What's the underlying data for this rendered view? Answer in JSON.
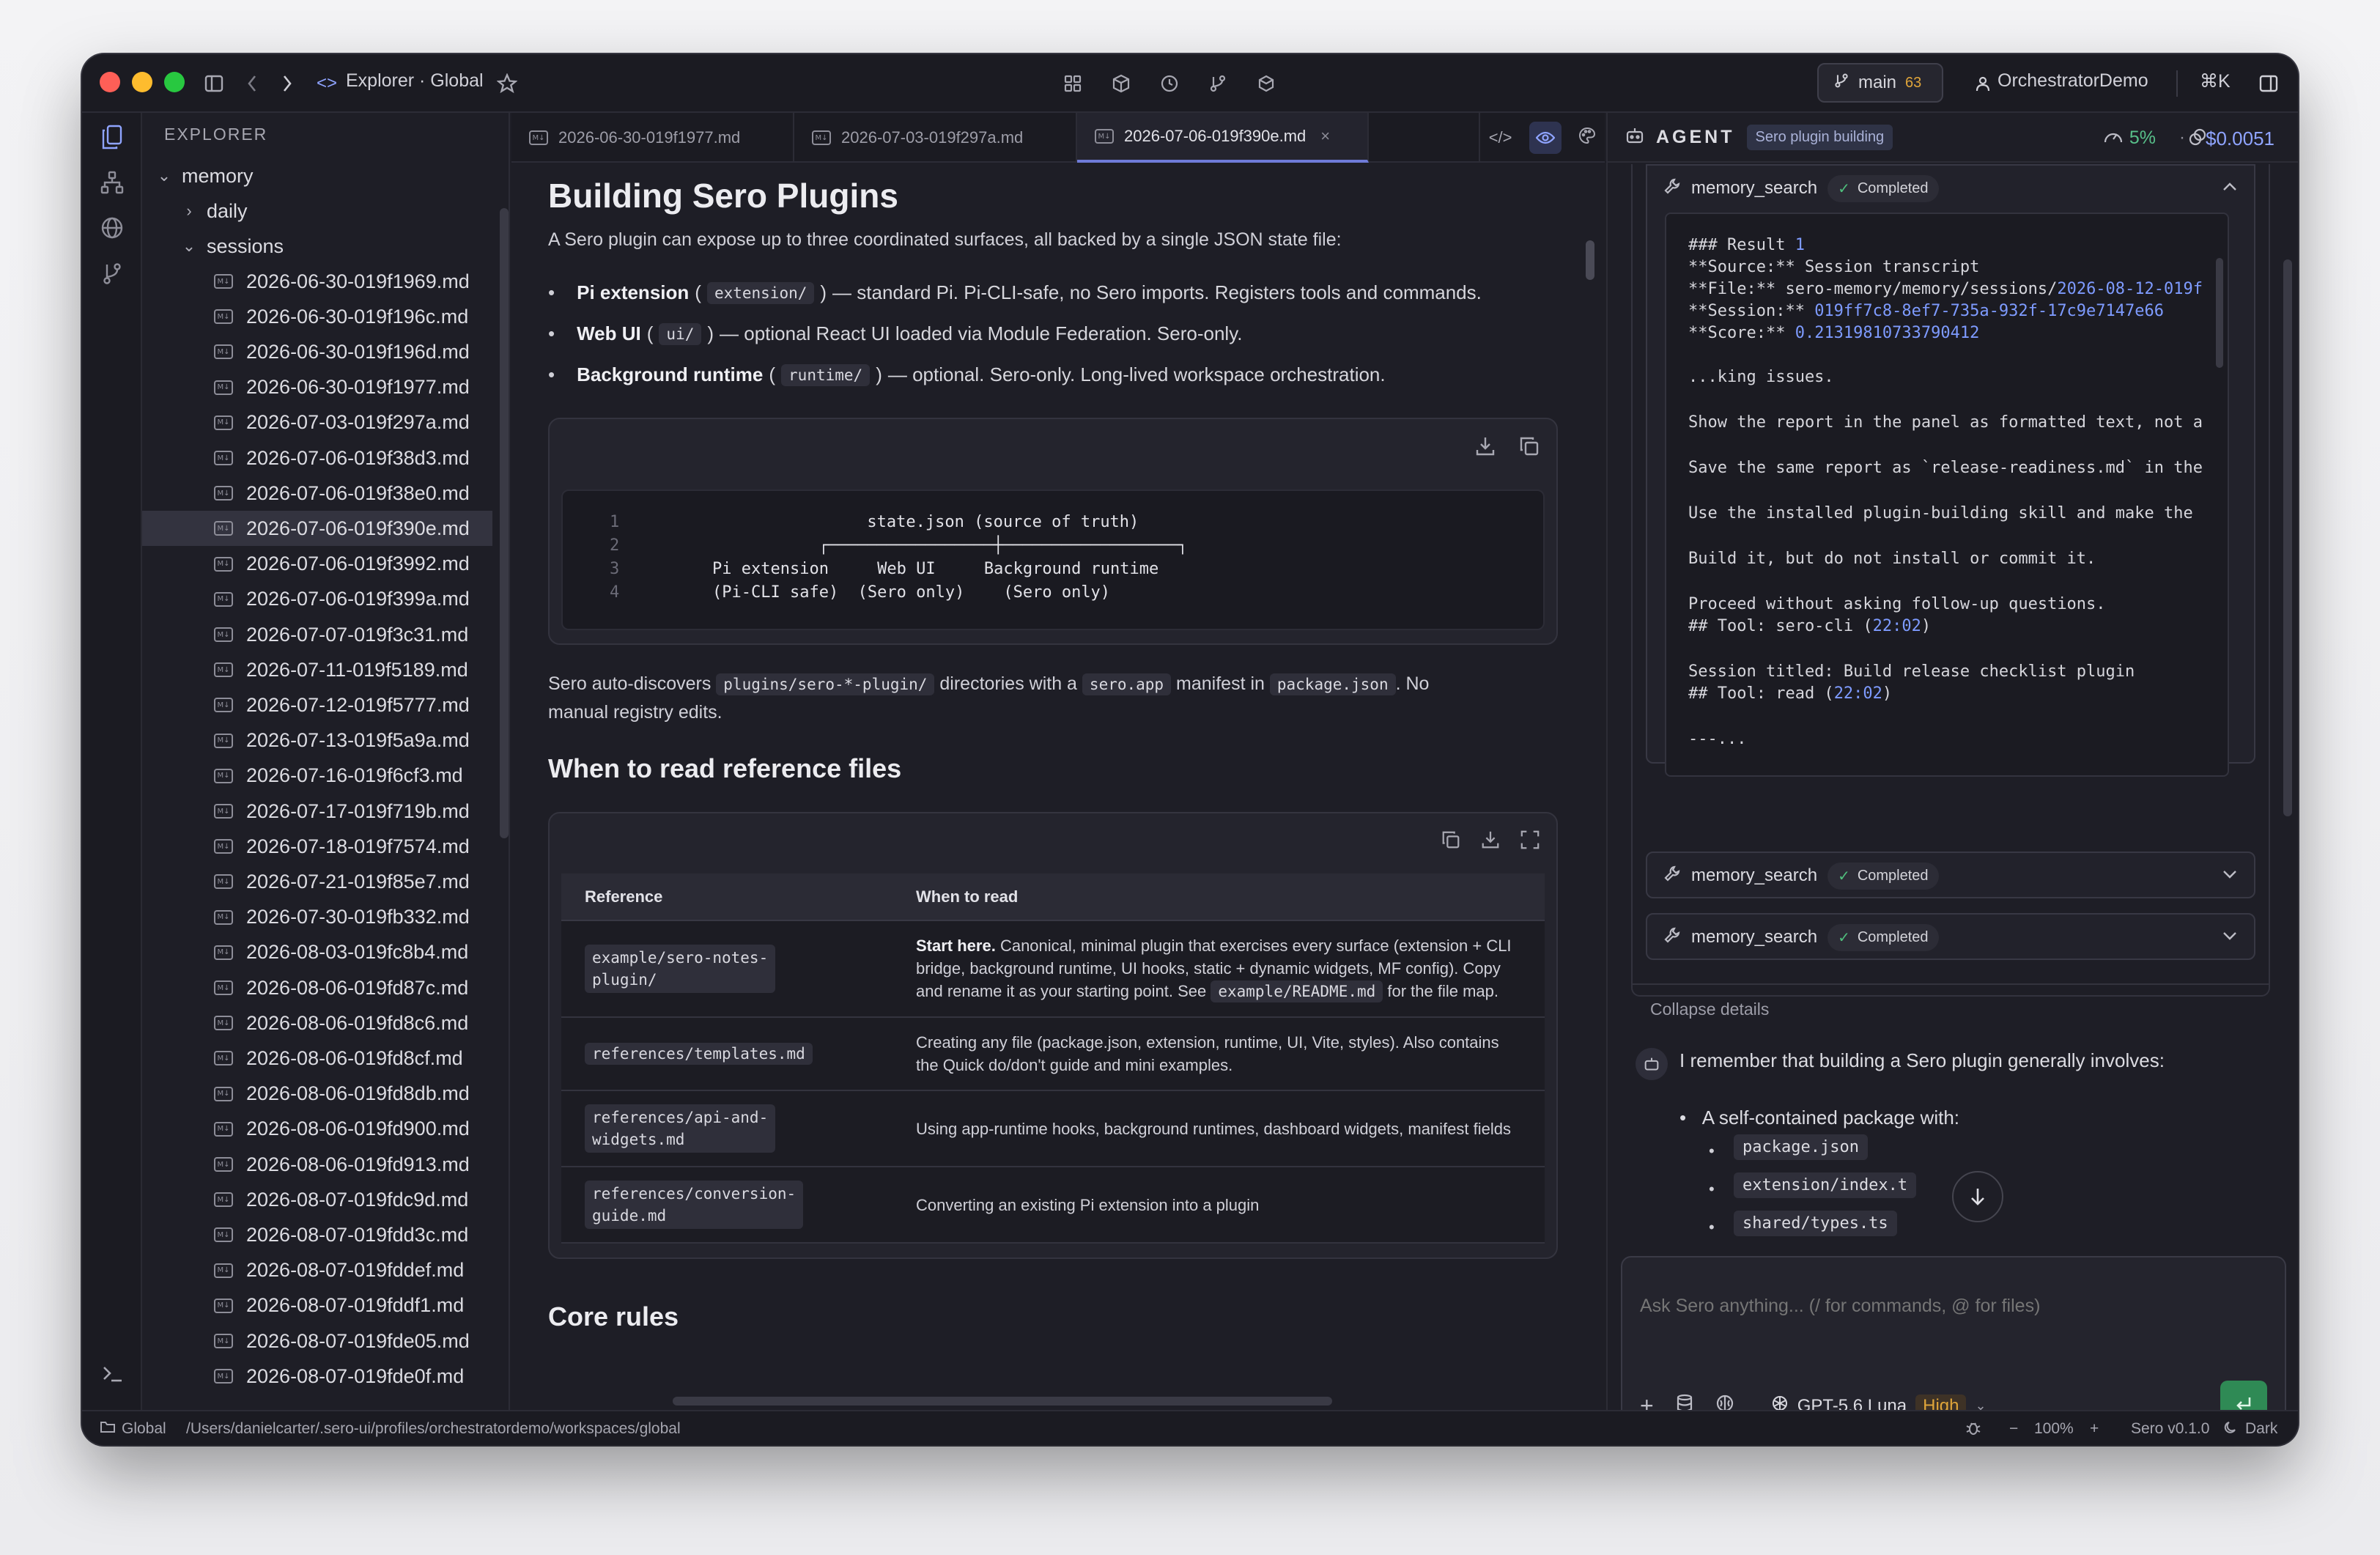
{
  "titlebar": {
    "breadcrumb": "Explorer · Global",
    "branch": "main",
    "branch_count": "63",
    "user": "OrchestratorDemo",
    "shortcut": "⌘K"
  },
  "sidebar": {
    "title": "EXPLORER",
    "folders": {
      "root": "memory",
      "daily": "daily",
      "sessions": "sessions"
    },
    "files": [
      "2026-06-30-019f1969.md",
      "2026-06-30-019f196c.md",
      "2026-06-30-019f196d.md",
      "2026-06-30-019f1977.md",
      "2026-07-03-019f297a.md",
      "2026-07-06-019f38d3.md",
      "2026-07-06-019f38e0.md",
      "2026-07-06-019f390e.md",
      "2026-07-06-019f3992.md",
      "2026-07-06-019f399a.md",
      "2026-07-07-019f3c31.md",
      "2026-07-11-019f5189.md",
      "2026-07-12-019f5777.md",
      "2026-07-13-019f5a9a.md",
      "2026-07-16-019f6cf3.md",
      "2026-07-17-019f719b.md",
      "2026-07-18-019f7574.md",
      "2026-07-21-019f85e7.md",
      "2026-07-30-019fb332.md",
      "2026-08-03-019fc8b4.md",
      "2026-08-06-019fd87c.md",
      "2026-08-06-019fd8c6.md",
      "2026-08-06-019fd8cf.md",
      "2026-08-06-019fd8db.md",
      "2026-08-06-019fd900.md",
      "2026-08-06-019fd913.md",
      "2026-08-07-019fdc9d.md",
      "2026-08-07-019fdd3c.md",
      "2026-08-07-019fddef.md",
      "2026-08-07-019fddf1.md",
      "2026-08-07-019fde05.md",
      "2026-08-07-019fde0f.md"
    ]
  },
  "tabs": [
    {
      "label": "2026-06-30-019f1977.md"
    },
    {
      "label": "2026-07-03-019f297a.md"
    },
    {
      "label": "2026-07-06-019f390e.md",
      "close": "×"
    }
  ],
  "doc": {
    "h1": "Building Sero Plugins",
    "intro": "A Sero plugin can expose up to three coordinated surfaces, all backed by a single JSON state file:",
    "bullets": [
      {
        "bold": "Pi extension",
        "code": "extension/",
        "rest": "— standard Pi. Pi-CLI-safe, no Sero imports. Registers tools and commands."
      },
      {
        "bold": "Web UI",
        "code": "ui/",
        "rest": "— optional React UI loaded via Module Federation. Sero-only."
      },
      {
        "bold": "Background runtime",
        "code": "runtime/",
        "rest": "— optional. Sero-only. Long-lived workspace orchestration."
      }
    ],
    "code_lines": [
      {
        "n": "1",
        "text": "              state.json (source of truth)"
      },
      {
        "n": "2",
        "text": "         ┌─────────────────┼──────────────────┐"
      },
      {
        "n": "3",
        "text": "Pi extension     Web UI     Background runtime"
      },
      {
        "n": "4",
        "text": "(Pi-CLI safe)  (Sero only)    (Sero only)"
      }
    ],
    "discover": {
      "a": "Sero auto-discovers",
      "code1": "plugins/sero-*-plugin/",
      "b": "directories with a",
      "code2": "sero.app",
      "c": "manifest in",
      "code3": "package.json",
      "d": ". No",
      "e": "manual registry edits."
    },
    "h2_ref": "When to read reference files",
    "table": {
      "headers": [
        "Reference",
        "When to read"
      ],
      "rows": [
        {
          "ref1": "example/sero-notes-",
          "ref2": "plugin/",
          "when_bold": "Start here.",
          "when": " Canonical, minimal plugin that exercises every surface (extension + CLI bridge, background runtime, UI hooks, static + dynamic widgets, MF config). Copy and rename it as your starting point. See ",
          "when_code": "example/README.md",
          "when_tail": " for the file map."
        },
        {
          "ref1": "references/templates.md",
          "ref2": "",
          "when": "Creating any file (package.json, extension, runtime, UI, Vite, styles). Also contains the Quick do/don't guide and mini examples."
        },
        {
          "ref1": "references/api-and-",
          "ref2": "widgets.md",
          "when": "Using app-runtime hooks, background runtimes, dashboard widgets, manifest fields"
        },
        {
          "ref1": "references/conversion-",
          "ref2": "guide.md",
          "when": "Converting an existing Pi extension into a plugin"
        }
      ]
    },
    "h2_core": "Core rules"
  },
  "agent": {
    "title": "AGENT",
    "tag": "Sero plugin building",
    "pct": "5%",
    "cost": "$0.0051",
    "tools": [
      {
        "name": "memory_search",
        "status": "Completed"
      },
      {
        "name": "memory_search",
        "status": "Completed"
      },
      {
        "name": "memory_search",
        "status": "Completed"
      }
    ],
    "result": {
      "l1a": "### Result ",
      "l1b": "1",
      "l2": "**Source:** Session transcript",
      "l3a": "**File:** sero-memory/memory/sessions/",
      "l3b": "2026-08-12-019f",
      "l4a": "**Session:** ",
      "l4b": "019ff7c8-8ef7-735a-932f-17c9e7147e66",
      "l5a": "**Score:** ",
      "l5b": "0.21319810733790412",
      "l6": "...king issues.",
      "l7": "Show the report in the panel as formatted text, not a",
      "l8": "Save the same report as `release-readiness.md` in the",
      "l9": "Use the installed plugin-building skill and make the",
      "l10": "Build it, but do not install or commit it.",
      "l11": "Proceed without asking follow-up questions.",
      "l12a": "## Tool: sero-cli (",
      "l12b": "22:02",
      "l12c": ")",
      "l13": "Session titled: Build release checklist plugin",
      "l14a": "## Tool: read (",
      "l14b": "22:02",
      "l14c": ")",
      "l15": "---..."
    },
    "collapse": "Collapse details",
    "message": "I remember that building a Sero plugin generally involves:",
    "list_head": "A self-contained package with:",
    "list_items": [
      "package.json",
      "extension/index.t",
      "shared/types.ts"
    ],
    "input_placeholder": "Ask Sero anything... (/ for commands, @ for files)",
    "model": "GPT-5.6 Luna",
    "effort": "High"
  },
  "statusbar": {
    "workspace": "Global",
    "path": "/Users/danielcarter/.sero-ui/profiles/orchestratordemo/workspaces/global",
    "zoom_minus": "−",
    "zoom": "100%",
    "zoom_plus": "+",
    "version": "Sero v0.1.0",
    "theme": "Dark"
  },
  "colors": {
    "accent": "#8fa4ff",
    "success": "#4fbf7d",
    "warning": "#e0a53a",
    "send": "#2f8a55"
  }
}
